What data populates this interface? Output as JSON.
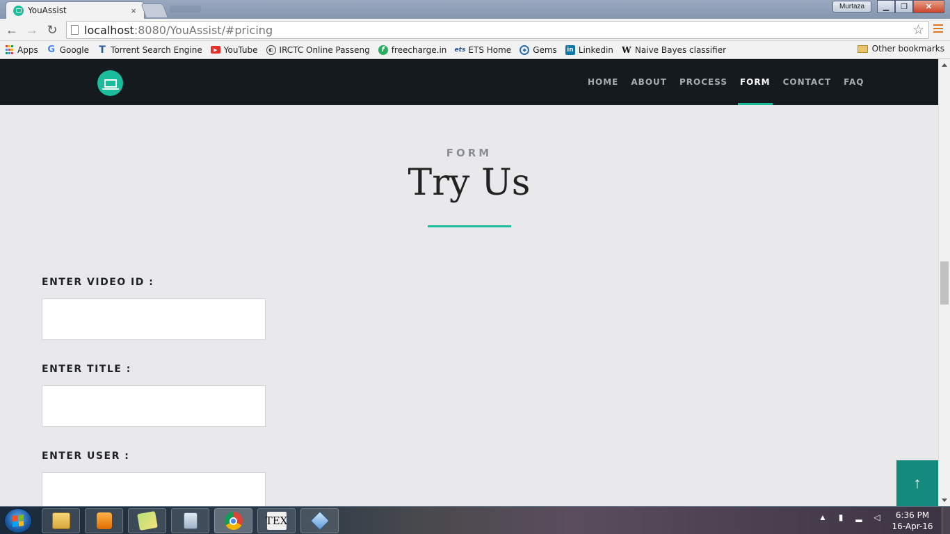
{
  "browser": {
    "tab_title": "YouAssist",
    "tab_close": "×",
    "user_name": "Murtaza",
    "url_host": "localhost",
    "url_rest": ":8080/YouAssist/#pricing",
    "bookmarks": [
      {
        "label": "Apps",
        "icon": "apps-grid-icon"
      },
      {
        "label": "Google",
        "icon": "google-icon"
      },
      {
        "label": "Torrent Search Engine",
        "icon": "torrent-icon"
      },
      {
        "label": "YouTube",
        "icon": "youtube-icon"
      },
      {
        "label": "IRCTC Online Passeng",
        "icon": "irctc-icon"
      },
      {
        "label": "freecharge.in",
        "icon": "freecharge-icon"
      },
      {
        "label": "ETS Home",
        "icon": "ets-icon"
      },
      {
        "label": "Gems",
        "icon": "gems-icon"
      },
      {
        "label": "Linkedin",
        "icon": "linkedin-icon"
      },
      {
        "label": "Naive Bayes classifier",
        "icon": "wikipedia-icon"
      }
    ],
    "other_bookmarks": "Other bookmarks"
  },
  "site": {
    "nav": {
      "home": "HOME",
      "about": "ABOUT",
      "process": "PROCESS",
      "form": "FORM",
      "contact": "CONTACT",
      "faq": "FAQ",
      "active": "FORM"
    },
    "section": {
      "eyebrow": "FORM",
      "title": "Try Us"
    },
    "form": {
      "video_id_label": "ENTER VIDEO ID :",
      "video_id_value": "",
      "title_label": "ENTER TITLE :",
      "title_value": "",
      "user_label": "ENTER USER :",
      "user_value": ""
    },
    "back_to_top": "↑"
  },
  "taskbar": {
    "time": "6:36 PM",
    "date": "16-Apr-16",
    "tex_label": "TEX"
  },
  "colors": {
    "accent": "#1abc9c",
    "nav_bg": "#151a1f",
    "page_bg": "#e9e9ec",
    "back_to_top_bg": "#138a7c"
  }
}
